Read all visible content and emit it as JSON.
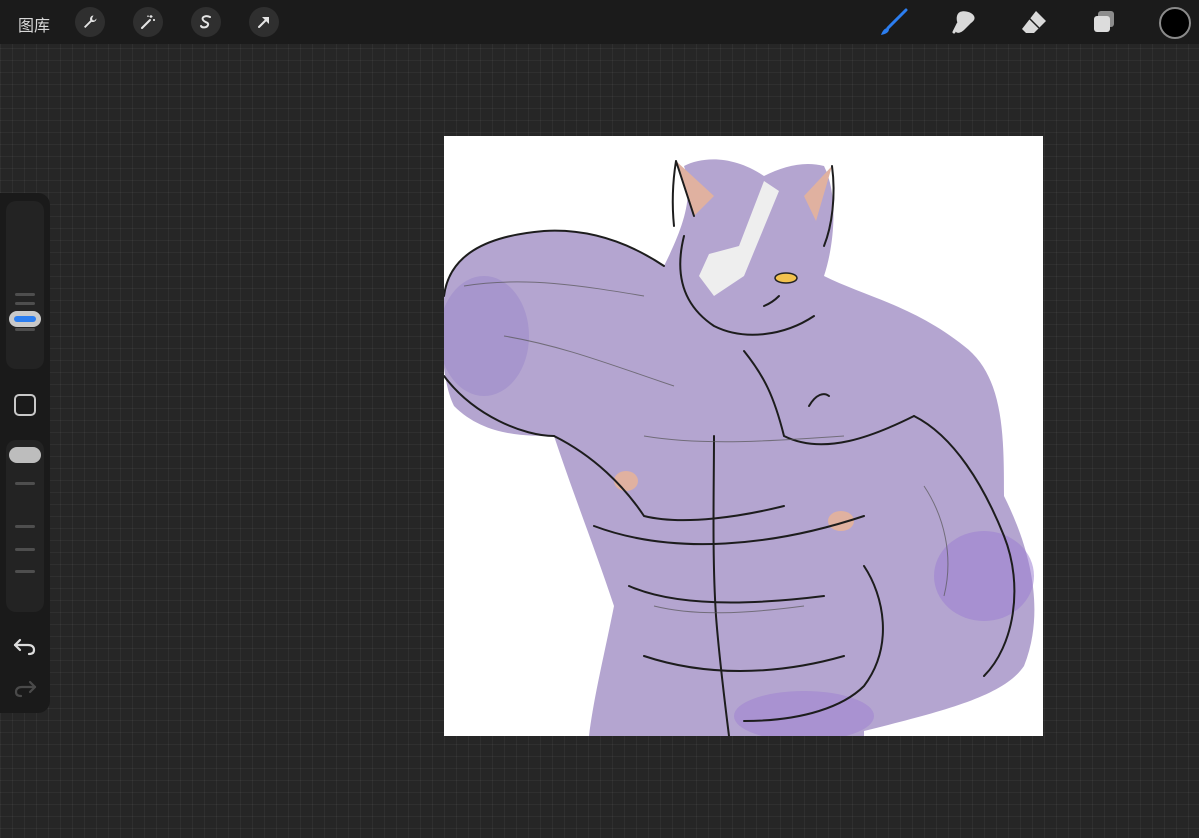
{
  "topbar": {
    "gallery_label": "图库",
    "left_tools": [
      "wrench-icon",
      "magic-wand-icon",
      "selection-icon",
      "transform-arrow-icon"
    ],
    "right_tools": [
      "brush-icon",
      "smudge-icon",
      "eraser-icon",
      "layers-icon"
    ],
    "active_tool": "brush-icon",
    "current_color": "#000000",
    "active_tool_color": "#2c7ef0"
  },
  "sidebar": {
    "brush_size_level": 0.84,
    "brush_opacity_level": 0.95,
    "controls": [
      "brush-size-slider",
      "modify-button",
      "brush-opacity-slider",
      "undo-button",
      "redo-button"
    ]
  },
  "canvas": {
    "background": "#ffffff",
    "fill_color": "#b4a5d0",
    "shade_color": "#9d7fd1",
    "accent_color": "#e0b1a0"
  }
}
